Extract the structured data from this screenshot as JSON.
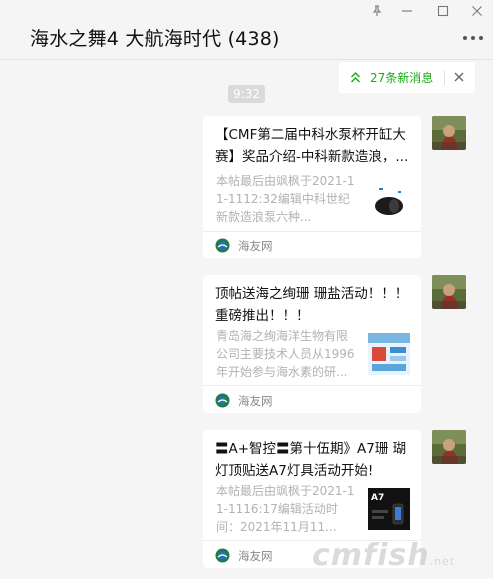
{
  "header": {
    "title": "海水之舞4 大航海时代 (438)"
  },
  "notice": {
    "text": "27条新消息"
  },
  "time": "9:32",
  "messages": [
    {
      "title": "【CMF第二届中科水泵杯开缸大赛】奖品介绍-中科新款造浪，...",
      "desc": "本帖最后由飒枫于2021-11-1112:32编辑中科世纪新款造浪泵六种...",
      "source": "海友网"
    },
    {
      "title": "顶帖送海之绚珊 珊盐活动！！！ 重磅推出！！！",
      "desc": "青岛海之绚海洋生物有限公司主要技术人员从1996年开始参与海水素的研...",
      "source": "海友网"
    },
    {
      "title": "〓A+智控〓第十伍期》A7珊 瑚灯顶贴送A7灯具活动开始!",
      "desc": "本帖最后由飒枫于2021-11-1116:17编辑活动时间：2021年11月11...",
      "source": "海友网"
    }
  ],
  "thumb3_label": "A7",
  "watermark": {
    "main": "cmfish",
    "suffix": ".net"
  },
  "colors": {
    "accent_green": "#1aad19",
    "background": "#f5f5f5",
    "card": "#ffffff"
  },
  "icons": [
    "pin-icon",
    "minimize-icon",
    "maximize-icon",
    "close-icon",
    "more-icon",
    "double-chevron-up-icon",
    "dismiss-icon",
    "source-logo-icon"
  ]
}
